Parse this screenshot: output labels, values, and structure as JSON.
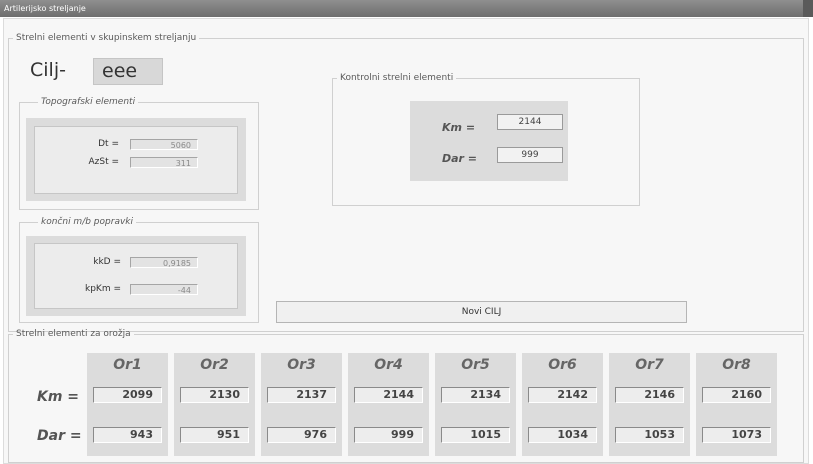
{
  "window": {
    "title": "Artilerijsko streljanje"
  },
  "main_group": {
    "legend": "Strelni elementi v skupinskem streljanju"
  },
  "target": {
    "label": "Cilj-",
    "value": "eee"
  },
  "topo": {
    "legend": "Topografski elementi",
    "dt_label": "Dt =",
    "dt_value": "5060",
    "azst_label": "AzSt =",
    "azst_value": "311"
  },
  "corrections": {
    "legend": "končni m/b popravki",
    "kkd_label": "kkD =",
    "kkd_value": "0,9185",
    "kpkm_label": "kpKm =",
    "kpkm_value": "-44"
  },
  "control": {
    "legend": "Kontrolni strelni elementi",
    "km_label": "Km =",
    "km_value": "2144",
    "dar_label": "Dar =",
    "dar_value": "999"
  },
  "new_target_button": "Novi CILJ",
  "weapons": {
    "legend": "Strelni elementi za orožja",
    "km_label": "Km =",
    "dar_label": "Dar =",
    "columns": [
      {
        "name": "Or1",
        "km": "2099",
        "dar": "943"
      },
      {
        "name": "Or2",
        "km": "2130",
        "dar": "951"
      },
      {
        "name": "Or3",
        "km": "2137",
        "dar": "976"
      },
      {
        "name": "Or4",
        "km": "2144",
        "dar": "999"
      },
      {
        "name": "Or5",
        "km": "2134",
        "dar": "1015"
      },
      {
        "name": "Or6",
        "km": "2142",
        "dar": "1034"
      },
      {
        "name": "Or7",
        "km": "2146",
        "dar": "1053"
      },
      {
        "name": "Or8",
        "km": "2160",
        "dar": "1073"
      }
    ]
  }
}
